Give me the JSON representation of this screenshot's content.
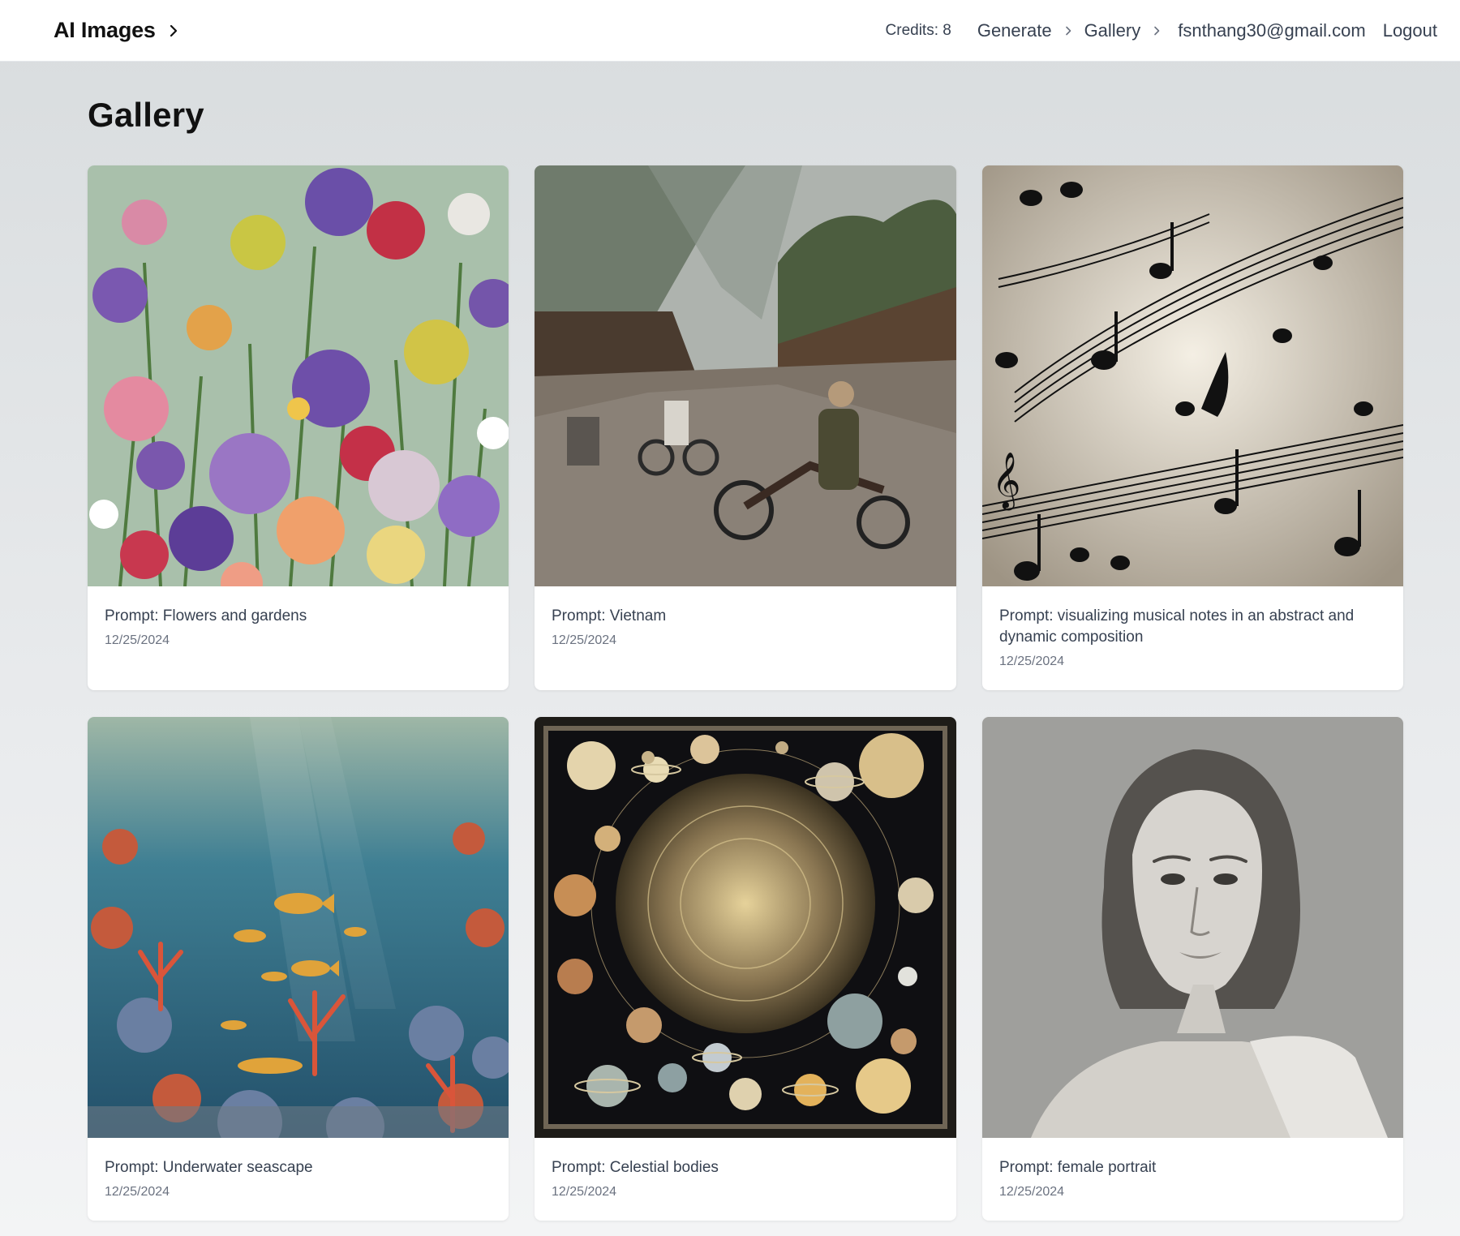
{
  "header": {
    "brand": "AI Images",
    "credits": "Credits: 8",
    "nav": [
      "Generate",
      "Gallery"
    ],
    "email": "fsnthang30@gmail.com",
    "logout": "Logout"
  },
  "page": {
    "title": "Gallery"
  },
  "gallery": [
    {
      "prompt": "Prompt: Flowers and gardens",
      "date": "12/25/2024",
      "image": "flowers-garden-image"
    },
    {
      "prompt": "Prompt: Vietnam",
      "date": "12/25/2024",
      "image": "vietnam-street-image"
    },
    {
      "prompt": "Prompt: visualizing musical notes in an abstract and dynamic composition",
      "date": "12/25/2024",
      "image": "musical-notes-image"
    },
    {
      "prompt": "Prompt: Underwater seascape",
      "date": "12/25/2024",
      "image": "underwater-seascape-image"
    },
    {
      "prompt": "Prompt: Celestial bodies",
      "date": "12/25/2024",
      "image": "celestial-bodies-image"
    },
    {
      "prompt": "Prompt: female portrait",
      "date": "12/25/2024",
      "image": "female-portrait-image"
    }
  ]
}
